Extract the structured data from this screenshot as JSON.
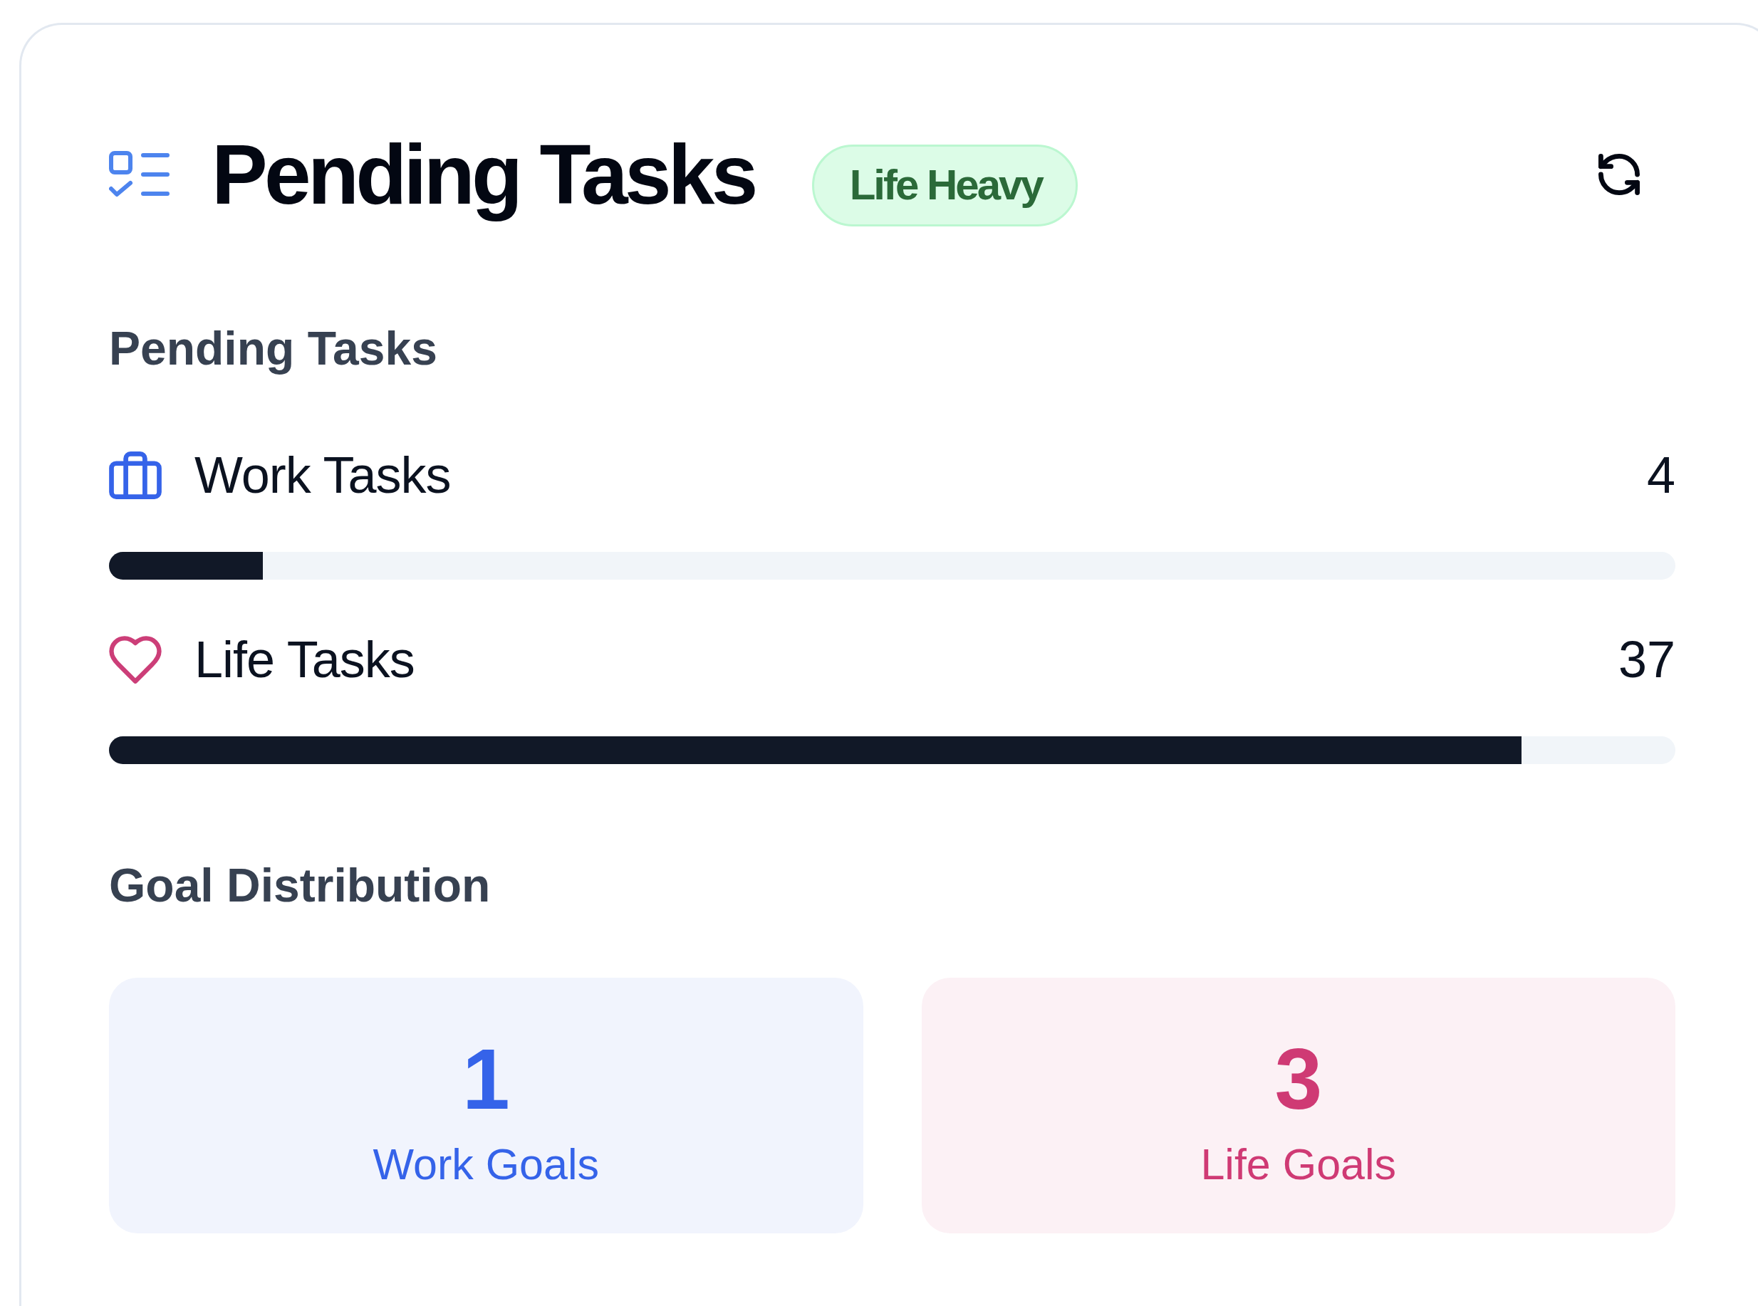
{
  "header": {
    "title": "Pending Tasks",
    "badge": "Life Heavy"
  },
  "pending_tasks": {
    "heading": "Pending Tasks",
    "items": [
      {
        "kind": "work",
        "label": "Work Tasks",
        "count": "4",
        "level": 0.098,
        "color": "#3563e9"
      },
      {
        "kind": "life",
        "label": "Life Tasks",
        "count": "37",
        "level": 0.902,
        "color": "#cc3e78"
      }
    ]
  },
  "goal_distribution": {
    "heading": "Goal Distribution",
    "cards": [
      {
        "value": "1",
        "label": "Work Goals",
        "color": "#3563e9"
      },
      {
        "value": "3",
        "label": "Life Goals",
        "color": "#cf3a74"
      }
    ]
  }
}
